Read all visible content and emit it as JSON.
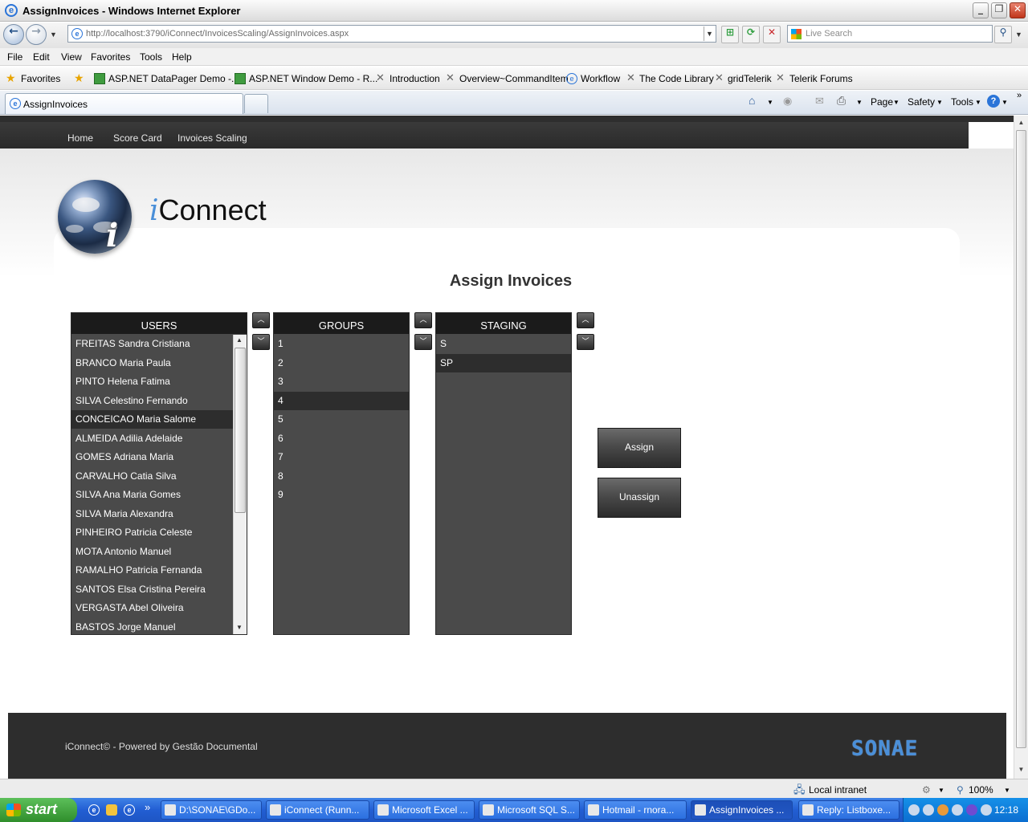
{
  "window": {
    "title": "AssignInvoices - Windows Internet Explorer"
  },
  "browser": {
    "url": "http://localhost:3790/iConnect/InvoicesScaling/AssignInvoices.aspx",
    "search_placeholder": "Live Search",
    "menu": [
      "File",
      "Edit",
      "View",
      "Favorites",
      "Tools",
      "Help"
    ],
    "favorites_label": "Favorites",
    "favorites": [
      "ASP.NET DataPager Demo -...",
      "ASP.NET Window Demo - R...",
      "Introduction",
      "Overview~CommandItem",
      "Workflow",
      "The Code Library",
      "gridTelerik",
      "Telerik Forums"
    ],
    "tab_title": "AssignInvoices",
    "command_bar": [
      "Page",
      "Safety",
      "Tools"
    ],
    "status_zone": "Local intranet",
    "zoom": "100%"
  },
  "site": {
    "nav": [
      "Home",
      "Score Card",
      "Invoices Scaling"
    ],
    "brand_i": "i",
    "brand_rest": "Connect",
    "page_title": "Assign Invoices",
    "users": {
      "header": "USERS",
      "items": [
        "FREITAS Sandra Cristiana",
        "BRANCO Maria Paula",
        "PINTO Helena Fatima",
        "SILVA Celestino Fernando",
        "CONCEICAO Maria Salome",
        "ALMEIDA Adilia Adelaide",
        "GOMES Adriana Maria",
        "CARVALHO Catia Silva",
        "SILVA Ana Maria Gomes",
        "SILVA Maria Alexandra",
        "PINHEIRO Patricia Celeste",
        "MOTA Antonio Manuel",
        "RAMALHO Patricia Fernanda",
        "SANTOS Elsa Cristina Pereira",
        "VERGASTA Abel Oliveira",
        "BASTOS Jorge Manuel"
      ],
      "selected": "CONCEICAO Maria Salome"
    },
    "groups": {
      "header": "GROUPS",
      "items": [
        "1",
        "2",
        "3",
        "4",
        "5",
        "6",
        "7",
        "8",
        "9"
      ],
      "selected": "4"
    },
    "staging": {
      "header": "STAGING",
      "items": [
        "S",
        "SP"
      ],
      "selected": "SP"
    },
    "assign_label": "Assign",
    "unassign_label": "Unassign",
    "footer_text": "iConnect© - Powered by Gestão Documental",
    "footer_logo": "SONAE"
  },
  "taskbar": {
    "start_label": "start",
    "tasks": [
      "D:\\SONAE\\GDo...",
      "iConnect (Runn...",
      "Microsoft Excel ...",
      "Microsoft SQL S...",
      "Hotmail - rnora...",
      "AssignInvoices ...",
      "Reply: Listboxe..."
    ],
    "active_task": "AssignInvoices ...",
    "clock": "12:18"
  }
}
